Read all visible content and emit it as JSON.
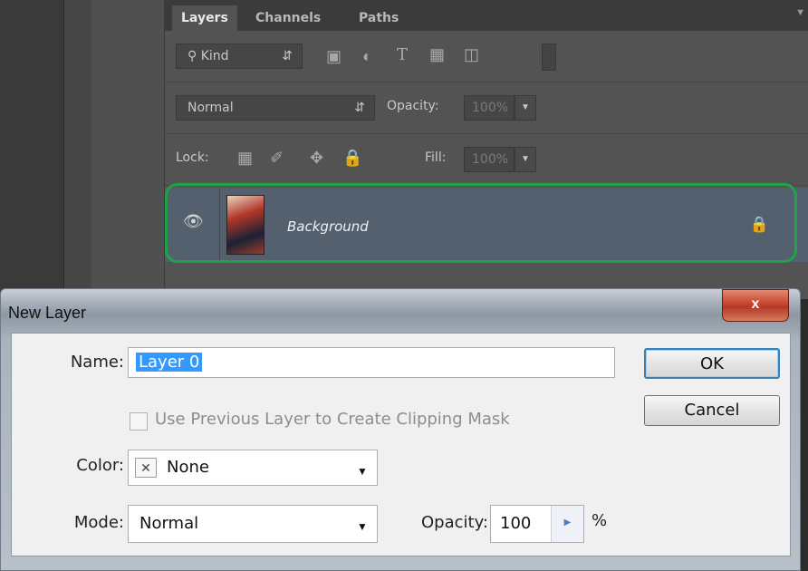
{
  "panel": {
    "tabs": [
      {
        "label": "Layers"
      },
      {
        "label": "Channels"
      },
      {
        "label": "Paths"
      }
    ],
    "filter": {
      "label": "Kind"
    },
    "blend_mode": "Normal",
    "opacity_label": "Opacity:",
    "opacity_value": "100%",
    "lock_label": "Lock:",
    "fill_label": "Fill:",
    "fill_value": "100%",
    "layer": {
      "name": "Background"
    }
  },
  "dialog": {
    "title": "New Layer",
    "close_label": "x",
    "name_label": "Name:",
    "name_value": "Layer 0",
    "clipping_label": "Use Previous Layer to Create Clipping Mask",
    "color_label": "Color:",
    "color_value": "None",
    "mode_label": "Mode:",
    "mode_value": "Normal",
    "opacity_label": "Opacity:",
    "opacity_value": "100",
    "percent_label": "%",
    "ok_label": "OK",
    "cancel_label": "Cancel"
  },
  "colors": {
    "highlight_outline": "#1fa34a",
    "selection": "#3399ff"
  }
}
